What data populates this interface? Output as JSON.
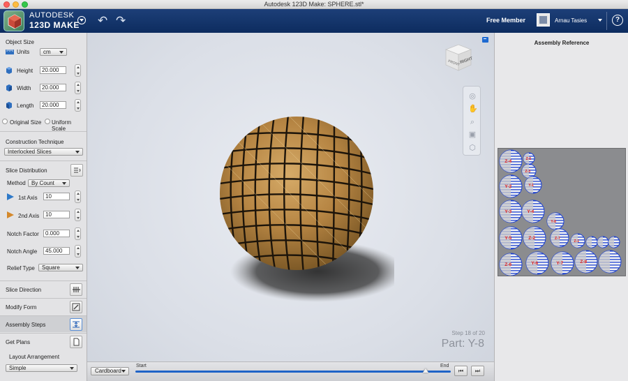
{
  "window": {
    "title": "Autodesk 123D Make: SPHERE.stl*"
  },
  "app": {
    "brand_line1": "AUTODESK",
    "brand_line2": "123D MAKE"
  },
  "header": {
    "account_label": "Free Member",
    "user_name": "Arnau Tasies",
    "help_label": "?"
  },
  "object_size": {
    "title": "Object Size",
    "units_label": "Units",
    "units_value": "cm",
    "height_label": "Height",
    "height_value": "20.000",
    "width_label": "Width",
    "width_value": "20.000",
    "length_label": "Length",
    "length_value": "20.000",
    "original_size_label": "Original Size",
    "uniform_scale_label": "Uniform Scale"
  },
  "construction": {
    "title": "Construction Technique",
    "value": "Interlocked Slices"
  },
  "slice_distribution": {
    "title": "Slice Distribution",
    "method_label": "Method",
    "method_value": "By Count",
    "axis1_label": "1st Axis",
    "axis1_value": "10",
    "axis2_label": "2nd Axis",
    "axis2_value": "10",
    "notch_factor_label": "Notch Factor",
    "notch_factor_value": "0.000",
    "notch_angle_label": "Notch Angle",
    "notch_angle_value": "45.000",
    "relief_type_label": "Relief Type",
    "relief_type_value": "Square"
  },
  "sections": {
    "slice_direction": "Slice Direction",
    "modify_form": "Modify Form",
    "assembly_steps": "Assembly Steps",
    "get_plans": "Get Plans"
  },
  "plans": {
    "layout_label": "Layout Arrangement",
    "layout_value": "Simple"
  },
  "viewcube": {
    "front_label": "FRONT",
    "right_label": "RIGHT"
  },
  "viewport": {
    "step_text": "Step 18 of 20",
    "part_text": "Part: Y-8",
    "material_value": "Cardboard",
    "timeline_start": "Start",
    "timeline_end": "End",
    "timeline_progress": 0.92
  },
  "right_panel": {
    "title": "Assembly Reference",
    "labels": [
      "Z-4",
      "Z-5",
      "Z-3",
      "Y-2",
      "Y-1",
      "Y-3",
      "Y-4",
      "Y-8",
      "Y-5",
      "Z-2",
      "Z-7",
      "Z-1",
      "Z-6",
      "Y-6",
      "Y-7",
      "Z-8"
    ]
  },
  "colors": {
    "brand_blue": "#0d2c5f",
    "accent_blue": "#1f63c7",
    "sphere_tan": "#b88a45",
    "slice_blue": "#1a3fd0",
    "slice_red": "#e02020"
  }
}
